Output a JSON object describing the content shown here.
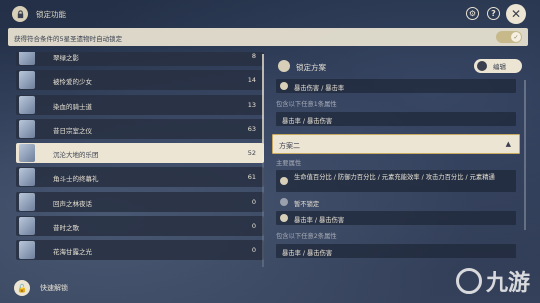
{
  "header": {
    "title": "锁定功能",
    "buttons": [
      "settings-icon",
      "help-icon",
      "close-icon"
    ]
  },
  "autolock": {
    "label": "获得符合条件的5星圣遗物时自动锁定",
    "enabled": true
  },
  "artifact_sets": [
    {
      "name": "翠绿之影",
      "count": "8"
    },
    {
      "name": "被怜爱的少女",
      "count": "14"
    },
    {
      "name": "染血的骑士道",
      "count": "13"
    },
    {
      "name": "昔日宗室之仪",
      "count": "63"
    },
    {
      "name": "沉沦大地的乐团",
      "count": "52",
      "selected": true
    },
    {
      "name": "角斗士的终幕礼",
      "count": "61"
    },
    {
      "name": "回声之林夜话",
      "count": "0"
    },
    {
      "name": "昔时之歌",
      "count": "0"
    },
    {
      "name": "花海甘露之光",
      "count": "0"
    }
  ],
  "quick_unlock": {
    "label": "快速解锁"
  },
  "lock_plans": {
    "title": "锁定方案",
    "edit_label": "编辑",
    "plan1": {
      "main_line": "暴击伤害 / 暴击率",
      "include_label": "包含以下任意1条属性",
      "sub_line": "暴击率 / 暴击伤害"
    },
    "plan2": {
      "label": "方案二",
      "main_stat_heading": "主要属性",
      "main_line": "生命值百分比 / 防御力百分比 / 元素充能效率 / 攻击力百分比 / 元素精通",
      "unlocked_label": "暂不锁定",
      "stat_line": "暴击率 / 暴击伤害",
      "include_label": "包含以下任意2条属性",
      "sub_line": "暴击率 / 暴击伤害"
    }
  },
  "watermark": {
    "text": "九游"
  }
}
